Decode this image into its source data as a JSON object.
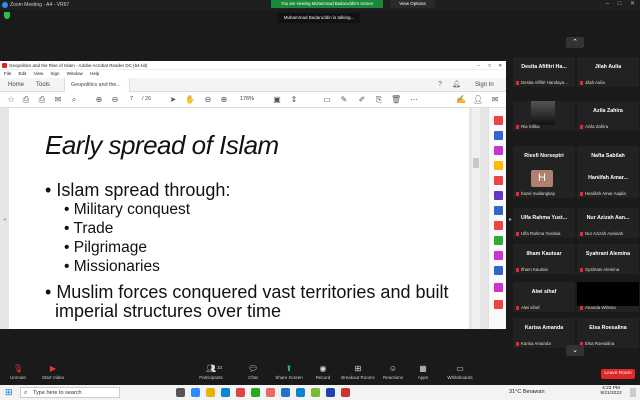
{
  "zoom": {
    "title": "Zoom Meeting - A4 - VR67",
    "share_banner": "You are viewing Muhammad Badaruddin's screen",
    "view_options": "View Options",
    "talking": "Muhammad Badaruddin is talking..."
  },
  "acrobat": {
    "title": "Geopolitics and the Rise of Islam - Adobe Acrobat Reader DC (64-bit)",
    "menu": [
      "File",
      "Edit",
      "View",
      "Sign",
      "Window",
      "Help"
    ],
    "tabs": [
      "Home",
      "Tools"
    ],
    "doc_tab": "Geopolitics and the...",
    "sign_in": "Sign In",
    "page_current": "7",
    "page_total": "/ 26",
    "zoom": "176%"
  },
  "slide": {
    "title": "Early spread of Islam",
    "bullets": [
      {
        "text": "Islam spread through:",
        "level": 1
      },
      {
        "text": "Military conquest",
        "level": 2
      },
      {
        "text": "Trade",
        "level": 2
      },
      {
        "text": "Pilgrimage",
        "level": 2
      },
      {
        "text": "Missionaries",
        "level": 2
      },
      {
        "text": "Muslim forces conquered vast territories and built",
        "level": 1
      },
      {
        "text": "imperial structures over time",
        "level": 0
      }
    ]
  },
  "participants": [
    {
      "name": "Destia Afifitri Ha...",
      "sub": "Destia Afifitri Handaya..."
    },
    {
      "name": "Jilah Aulia",
      "sub": "Jilah Aulia"
    },
    {
      "name": "",
      "sub": "Ria Sifika"
    },
    {
      "name": "Azila Zahira",
      "sub": "Azila Zahira"
    },
    {
      "name": "Riesfi Norseptri",
      "sub": "Riesfi Norseptri"
    },
    {
      "name": "Nafta Sabilah",
      "sub": "Nafta Sabilah"
    },
    {
      "name": "H",
      "sub": "hazel mailangkay"
    },
    {
      "name": "Haniifah Amar...",
      "sub": "Haniifah Amar Aaqila"
    },
    {
      "name": "Ulfa Rahma Yust...",
      "sub": "Ulfa Rahma Yustisia"
    },
    {
      "name": "Nur Azizah Aan...",
      "sub": "Nur Azizah Aanisah"
    },
    {
      "name": "Ilham Kautsar",
      "sub": "Ilham Kautsar"
    },
    {
      "name": "Syahrani Alemina",
      "sub": "Syahrani Alemina"
    },
    {
      "name": "Alwi sihaf",
      "sub": "Alwi sihaf"
    },
    {
      "name": "",
      "sub": "Ananda Wilsma"
    },
    {
      "name": "Karisa Amanda",
      "sub": "Karisa Amanda"
    },
    {
      "name": "Elsa Roesalina",
      "sub": "Elsa Roesalina"
    }
  ],
  "toolbar": {
    "unmute": "Unmute",
    "start_video": "Start Video",
    "participants": "Participants",
    "participants_count": "33",
    "chat": "Chat",
    "share_screen": "Share Screen",
    "record": "Record",
    "breakout": "Breakout Rooms",
    "reactions": "Reactions",
    "apps": "Apps",
    "whiteboards": "Whiteboards",
    "leave": "Leave Room"
  },
  "taskbar": {
    "search_placeholder": "Type here to search",
    "weather": "31°C  Berawan",
    "time": "4:23 PM",
    "date": "9/21/2022"
  },
  "colors": {
    "zoom_green": "#1a8a3a",
    "leave_red": "#e02828",
    "acrobat_red": "#d9261c",
    "muted_red": "#e22233"
  }
}
